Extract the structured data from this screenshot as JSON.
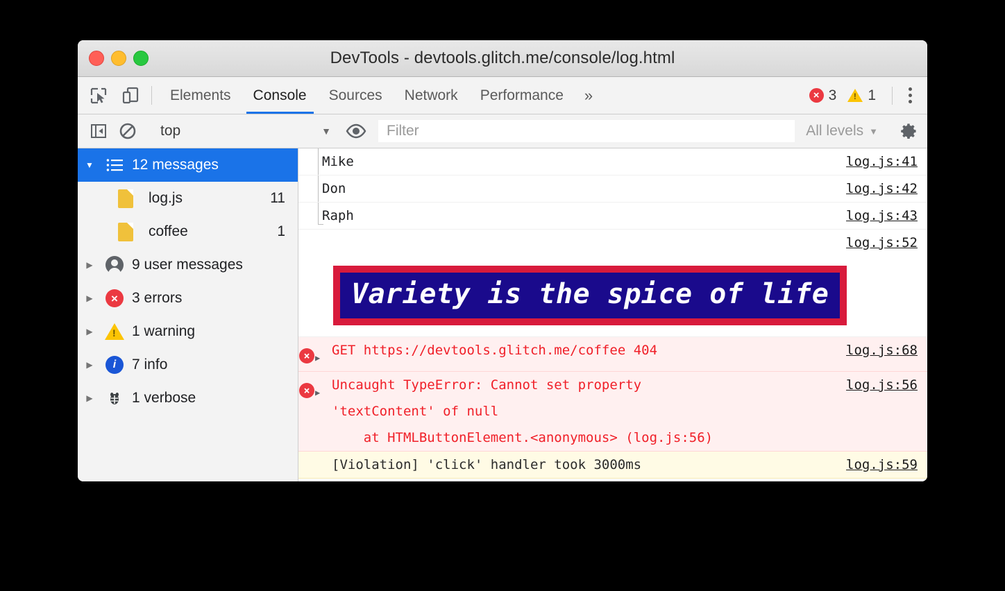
{
  "window": {
    "title": "DevTools - devtools.glitch.me/console/log.html",
    "traffic_lights": [
      "close",
      "minimize",
      "maximize"
    ]
  },
  "tabbar": {
    "inspect_icon": "inspect-element-icon",
    "device_icon": "device-toolbar-icon",
    "tabs": [
      {
        "label": "Elements",
        "active": false
      },
      {
        "label": "Console",
        "active": true
      },
      {
        "label": "Sources",
        "active": false
      },
      {
        "label": "Network",
        "active": false
      },
      {
        "label": "Performance",
        "active": false
      }
    ],
    "more_label": "»",
    "error_count": "3",
    "warning_count": "1",
    "menu_icon": "kebab-menu-icon"
  },
  "filterbar": {
    "sidebar_toggle_icon": "show-console-sidebar-icon",
    "clear_icon": "clear-console-icon",
    "context": "top",
    "context_caret": "▼",
    "eye_icon": "live-expression-eye-icon",
    "filter_placeholder": "Filter",
    "filter_value": "",
    "levels_label": "All levels",
    "levels_caret": "▼",
    "settings_icon": "settings-gear-icon"
  },
  "sidebar": {
    "root": {
      "twisty": "▼",
      "icon": "list-icon",
      "label": "12 messages",
      "selected": true
    },
    "children": [
      {
        "icon": "file-icon",
        "label": "log.js",
        "count": "11"
      },
      {
        "icon": "file-icon",
        "label": "coffee",
        "count": "1"
      }
    ],
    "groups": [
      {
        "twisty": "▶",
        "icon": "user-icon",
        "label": "9 user messages"
      },
      {
        "twisty": "▶",
        "icon": "error-icon",
        "label": "3 errors"
      },
      {
        "twisty": "▶",
        "icon": "warning-icon",
        "label": "1 warning"
      },
      {
        "twisty": "▶",
        "icon": "info-icon",
        "label": "7 info"
      },
      {
        "twisty": "▶",
        "icon": "bug-icon",
        "label": "1 verbose"
      }
    ]
  },
  "console": {
    "messages": [
      {
        "kind": "log-grouped",
        "text": "Mike",
        "source": "log.js:41"
      },
      {
        "kind": "log-grouped",
        "text": "Don",
        "source": "log.js:42"
      },
      {
        "kind": "log-grouped",
        "text": "Raph",
        "source": "log.js:43"
      },
      {
        "kind": "source-only",
        "text": "",
        "source": "log.js:52"
      },
      {
        "kind": "styled",
        "text": "Variety is the spice of life",
        "source": "",
        "style": {
          "background": "#1a0a8c",
          "border": "#d81b3c",
          "color": "#ffffff"
        }
      },
      {
        "kind": "error",
        "disclosure": "▶",
        "prefix": "GET ",
        "link": "https://devtools.glitch.me/coffee",
        "suffix": " 404",
        "source": "log.js:68"
      },
      {
        "kind": "error-stack",
        "disclosure": "▶",
        "line1": "Uncaught TypeError: Cannot set property",
        "line2": "'textContent' of null",
        "line3_prefix": "    at HTMLButtonElement.<anonymous> (",
        "line3_link": "log.js:56",
        "line3_suffix": ")",
        "source": "log.js:56"
      },
      {
        "kind": "warning",
        "text": "[Violation] 'click' handler took 3000ms",
        "source": "log.js:59"
      }
    ],
    "prompt": {
      "caret": "❯",
      "value": "",
      "placeholder": ""
    }
  },
  "colors": {
    "accent": "#1a73e8",
    "error": "#eb3941",
    "warning": "#fcc404",
    "info": "#1a56d6",
    "styled_bg": "#1a0a8c",
    "styled_border": "#d81b3c"
  }
}
